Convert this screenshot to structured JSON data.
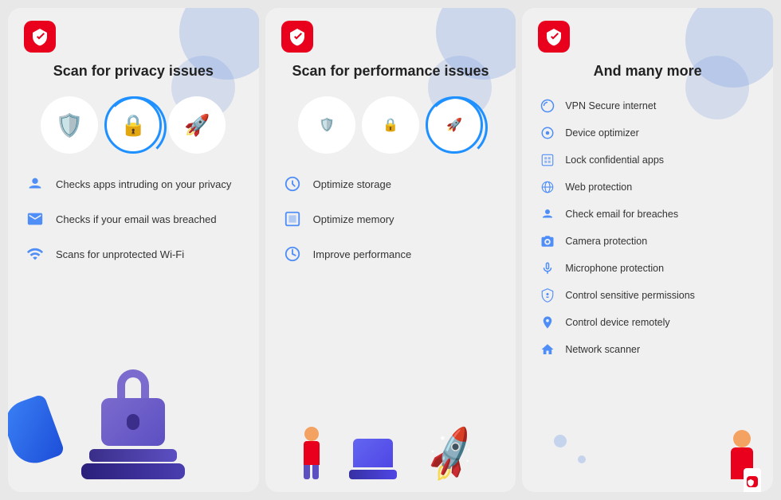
{
  "cards": [
    {
      "id": "card-1",
      "logo_alt": "Avira logo",
      "title": "Scan for privacy issues",
      "features": [
        {
          "icon": "👤",
          "text": "Checks apps intruding on your privacy"
        },
        {
          "icon": "✉️",
          "text": "Checks if your email was breached"
        },
        {
          "icon": "📶",
          "text": "Scans for unprotected Wi-Fi"
        }
      ]
    },
    {
      "id": "card-2",
      "logo_alt": "Avira logo",
      "title": "Scan for performance issues",
      "features": [
        {
          "icon": "⏱️",
          "text": "Optimize storage"
        },
        {
          "icon": "🔲",
          "text": "Optimize memory"
        },
        {
          "icon": "⏱️",
          "text": "Improve performance"
        }
      ]
    },
    {
      "id": "card-3",
      "logo_alt": "Avira logo",
      "title": "And many more",
      "more_items": [
        {
          "icon": "🔒",
          "text": "VPN Secure internet"
        },
        {
          "icon": "⚡",
          "text": "Device optimizer"
        },
        {
          "icon": "🔐",
          "text": "Lock confidential apps"
        },
        {
          "icon": "🌐",
          "text": "Web protection"
        },
        {
          "icon": "👤",
          "text": "Check email for breaches"
        },
        {
          "icon": "📷",
          "text": "Camera protection"
        },
        {
          "icon": "🎙️",
          "text": "Microphone protection"
        },
        {
          "icon": "🔑",
          "text": "Control sensitive permissions"
        },
        {
          "icon": "📍",
          "text": "Control device remotely"
        },
        {
          "icon": "🏠",
          "text": "Network scanner"
        }
      ]
    }
  ]
}
